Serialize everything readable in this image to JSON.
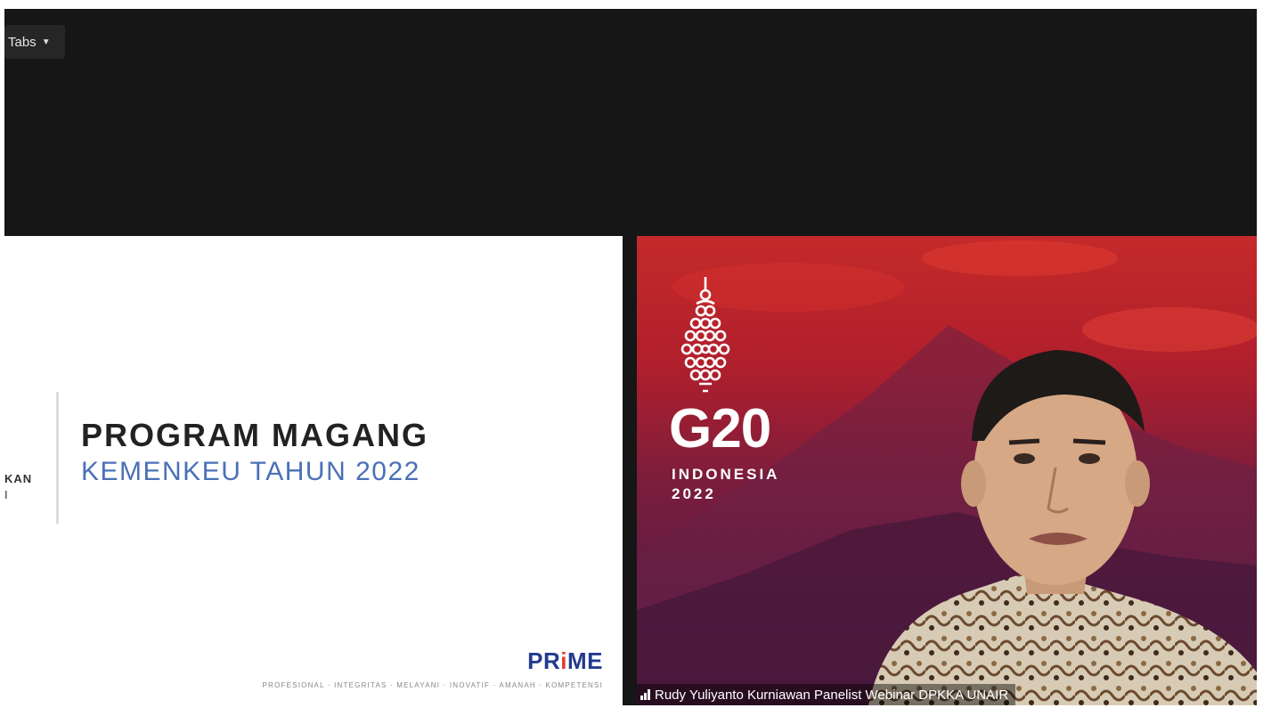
{
  "meeting": {
    "view_button": {
      "label": "Tabs",
      "icon": "chevron-down-icon"
    }
  },
  "slide": {
    "left_text_fragment_1": "KAN",
    "left_text_fragment_2": "I",
    "title": "PROGRAM MAGANG",
    "subtitle": "KEMENKEU TAHUN 2022",
    "logo_text_a": "PR",
    "logo_text_b": "i",
    "logo_text_c": "ME",
    "tagline": "PROFESIONAL · INTEGRITAS · MELAYANI · INOVATIF · AMANAH · KOMPETENSI"
  },
  "participant": {
    "g20_logo_text": "G20",
    "g20_country": "INDONESIA",
    "g20_year": "2022",
    "name_label": "Rudy Yuliyanto Kurniawan Panelist Webinar DPKKA UNAIR",
    "signal_icon": "signal-bars-icon"
  },
  "colors": {
    "stage_background": "#161616",
    "slide_title": "#222222",
    "slide_subtitle": "#4a70b8",
    "prime_blue": "#233a8f",
    "prime_red": "#e33b2e",
    "g20_background_top": "#c42a2a",
    "g20_background_bottom": "#4a1a3d"
  }
}
